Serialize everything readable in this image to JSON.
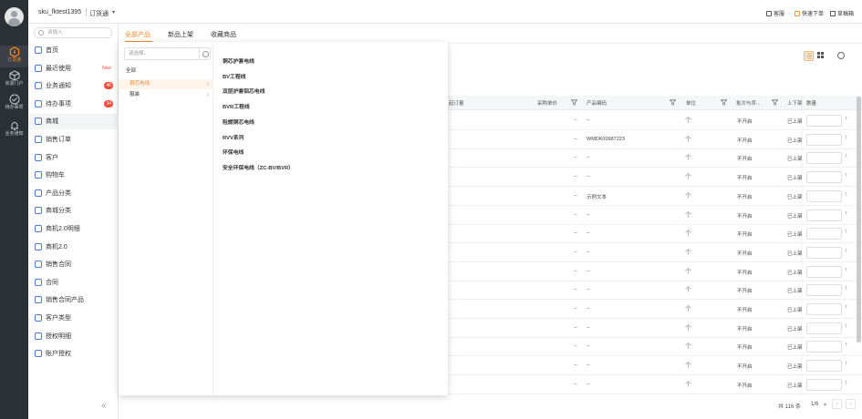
{
  "rail": {
    "items": [
      {
        "label": "订货通",
        "icon": "hexagon-icon"
      },
      {
        "label": "资源门户",
        "icon": "cube-icon"
      },
      {
        "label": "待办事项",
        "icon": "check-circle-icon"
      },
      {
        "label": "业务通知",
        "icon": "bell-icon"
      }
    ]
  },
  "topbar": {
    "username": "sku_fktest1395",
    "app_name": "订货通",
    "caret": "▾",
    "service": "客服",
    "quick_order": "快速下单",
    "draft": "草稿箱"
  },
  "menu": {
    "search_placeholder": "请输入",
    "items": [
      {
        "label": "首页"
      },
      {
        "label": "最近使用",
        "tag": "New"
      },
      {
        "label": "业务通知",
        "badge": "46"
      },
      {
        "label": "待办事项",
        "badge": "34"
      },
      {
        "label": "商城"
      },
      {
        "label": "销售订单"
      },
      {
        "label": "客户"
      },
      {
        "label": "购物车"
      },
      {
        "label": "产品分类"
      },
      {
        "label": "商城分类"
      },
      {
        "label": "商机2.0明细"
      },
      {
        "label": "商机2.0"
      },
      {
        "label": "销售合同"
      },
      {
        "label": "合同"
      },
      {
        "label": "销售合同产品"
      },
      {
        "label": "客户类型"
      },
      {
        "label": "授权明细"
      },
      {
        "label": "账户授权"
      }
    ],
    "collapse": "«"
  },
  "tabs": [
    "全部产品",
    "新品上架",
    "收藏商品"
  ],
  "table": {
    "headers": {
      "min_order": "起订量",
      "purchase_price": "采购单价",
      "product_code": "产品编码",
      "unit": "单位",
      "batch": "批次与序...",
      "status": "上下架",
      "qty": "数量"
    },
    "rows": [
      {
        "price": "--",
        "code": "--",
        "unit": "个",
        "batch": "不开启",
        "status": "已上架"
      },
      {
        "price": "--",
        "code": "WMDK00987223",
        "unit": "个",
        "batch": "不开启",
        "status": "已上架"
      },
      {
        "price": "--",
        "code": "--",
        "unit": "个",
        "batch": "不开启",
        "status": "已上架"
      },
      {
        "price": "--",
        "code": "--",
        "unit": "个",
        "batch": "不开启",
        "status": "已上架"
      },
      {
        "price": "--",
        "code": "示例文本",
        "unit": "个",
        "batch": "不开启",
        "status": "已上架"
      },
      {
        "price": "--",
        "code": "--",
        "unit": "个",
        "batch": "不开启",
        "status": "已上架"
      },
      {
        "price": "--",
        "code": "--",
        "unit": "个",
        "batch": "不开启",
        "status": "已上架"
      },
      {
        "price": "--",
        "code": "--",
        "unit": "个",
        "batch": "不开启",
        "status": "已上架"
      },
      {
        "price": "--",
        "code": "--",
        "unit": "个",
        "batch": "不开启",
        "status": "已上架"
      },
      {
        "price": "--",
        "code": "--",
        "unit": "个",
        "batch": "不开启",
        "status": "已上架"
      },
      {
        "price": "--",
        "code": "--",
        "unit": "个",
        "batch": "不开启",
        "status": "已上架"
      },
      {
        "price": "--",
        "code": "--",
        "unit": "个",
        "batch": "不开启",
        "status": "已上架"
      },
      {
        "price": "--",
        "code": "--",
        "unit": "个",
        "batch": "不开启",
        "status": "已上架"
      },
      {
        "price": "--",
        "code": "--",
        "unit": "个",
        "batch": "不开启",
        "status": "已上架"
      },
      {
        "price": "--",
        "code": "--",
        "unit": "个",
        "batch": "不开启",
        "status": "已上架"
      }
    ],
    "stepper_arrow": "↑"
  },
  "pagination": {
    "total": "共 116 条",
    "page": "1/6",
    "prev": "‹",
    "next": "›"
  },
  "dropdown": {
    "search_placeholder": "请选择...",
    "categories": [
      {
        "label": "全部"
      },
      {
        "label": "铜芯电线",
        "selected": true
      },
      {
        "label": "服装"
      }
    ],
    "subcategories": [
      "铜芯护套电线",
      "BV工程线",
      "双层护套铝芯电线",
      "BVR工程线",
      "阻燃铜芯电线",
      "RVV系列",
      "环保电线",
      "安全环保电线（ZC-BV/BVR）"
    ]
  },
  "colors": {
    "accent": "#f0892b",
    "badge": "#f14c3a",
    "rail_bg": "#2b2f36"
  }
}
